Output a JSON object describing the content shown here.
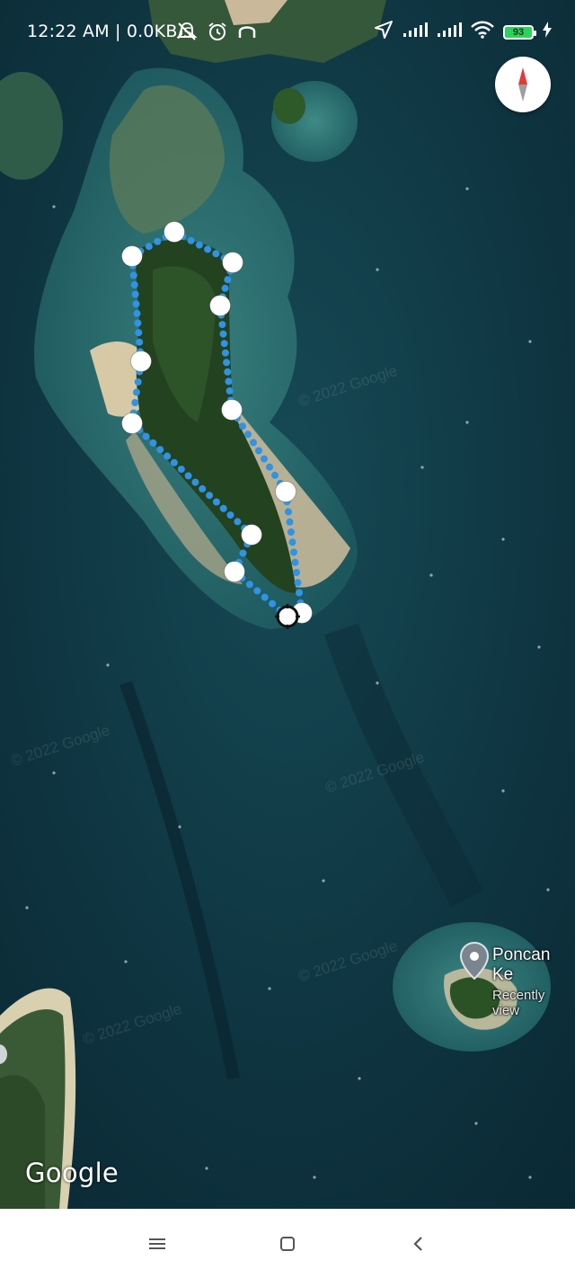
{
  "status_bar": {
    "time": "12:22 AM | 0.0KB/s",
    "battery": "93"
  },
  "map": {
    "place_label": {
      "name": "Poncan Ke",
      "subtitle": "Recently view"
    },
    "watermark": "© 2022 Google",
    "logo": "Google"
  },
  "icons": {
    "compass": "compass-icon",
    "place_pin": "map-pin-icon",
    "nav_menu": "menu-icon",
    "nav_home": "home-square-icon",
    "nav_back": "back-chevron-icon"
  },
  "colors": {
    "route_dots": "#2f93e6",
    "waypoint": "#ffffff",
    "ocean": "#0d3441",
    "land": "#2d4a2c"
  }
}
